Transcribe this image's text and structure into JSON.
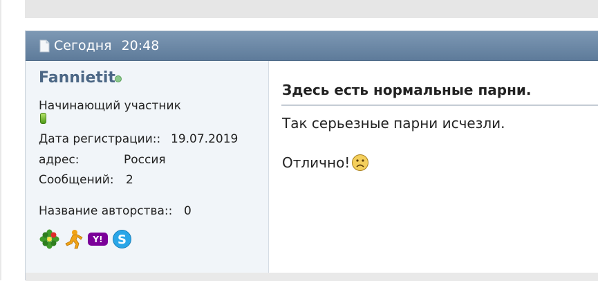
{
  "post": {
    "date": "Сегодня",
    "time": "20:48",
    "title": "Здесь есть нормальные парни.",
    "body_line1": "Так серьезные парни исчезли.",
    "body_line2": "Отлично!"
  },
  "user": {
    "name": "Fannietit",
    "status": "online",
    "usertitle": "Начинающий участник",
    "reg_label": "Дата регистрации::",
    "reg_value": "19.07.2019",
    "address_label": "адрес:",
    "address_value": "Россия",
    "posts_label": "Сообщений:",
    "posts_value": "2",
    "award_label": "Название авторства::",
    "award_value": "0"
  },
  "im_icons": [
    "icq-icon",
    "aim-icon",
    "yahoo-icon",
    "skype-icon"
  ],
  "colors": {
    "header": "#6a87a6",
    "username": "#4c6785",
    "panel": "#f1f5f9",
    "online": "#8bc88b"
  }
}
